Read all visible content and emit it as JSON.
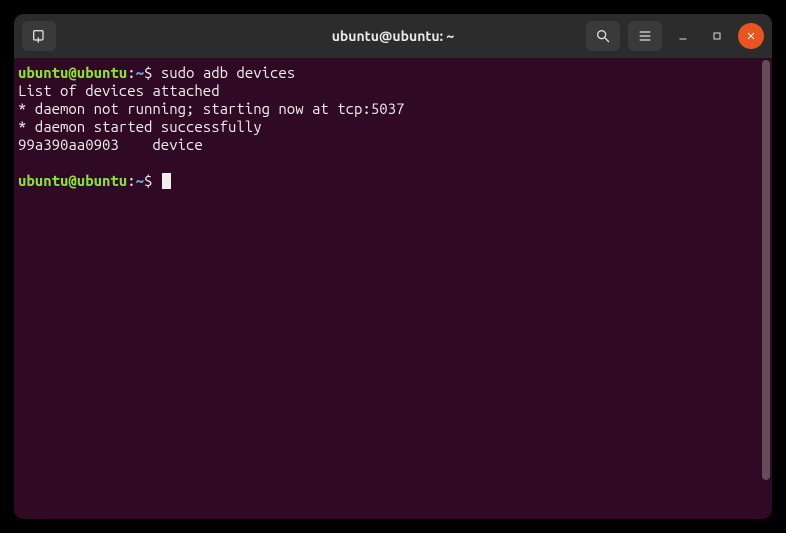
{
  "titlebar": {
    "title": "ubuntu@ubuntu: ~"
  },
  "prompt": {
    "user_host": "ubuntu@ubuntu",
    "colon": ":",
    "path": "~",
    "symbol": "$"
  },
  "session": {
    "command1": "sudo adb devices",
    "output_lines": [
      "List of devices attached",
      "* daemon not running; starting now at tcp:5037",
      "* daemon started successfully",
      "99a390aa0903    device"
    ],
    "command2": ""
  }
}
